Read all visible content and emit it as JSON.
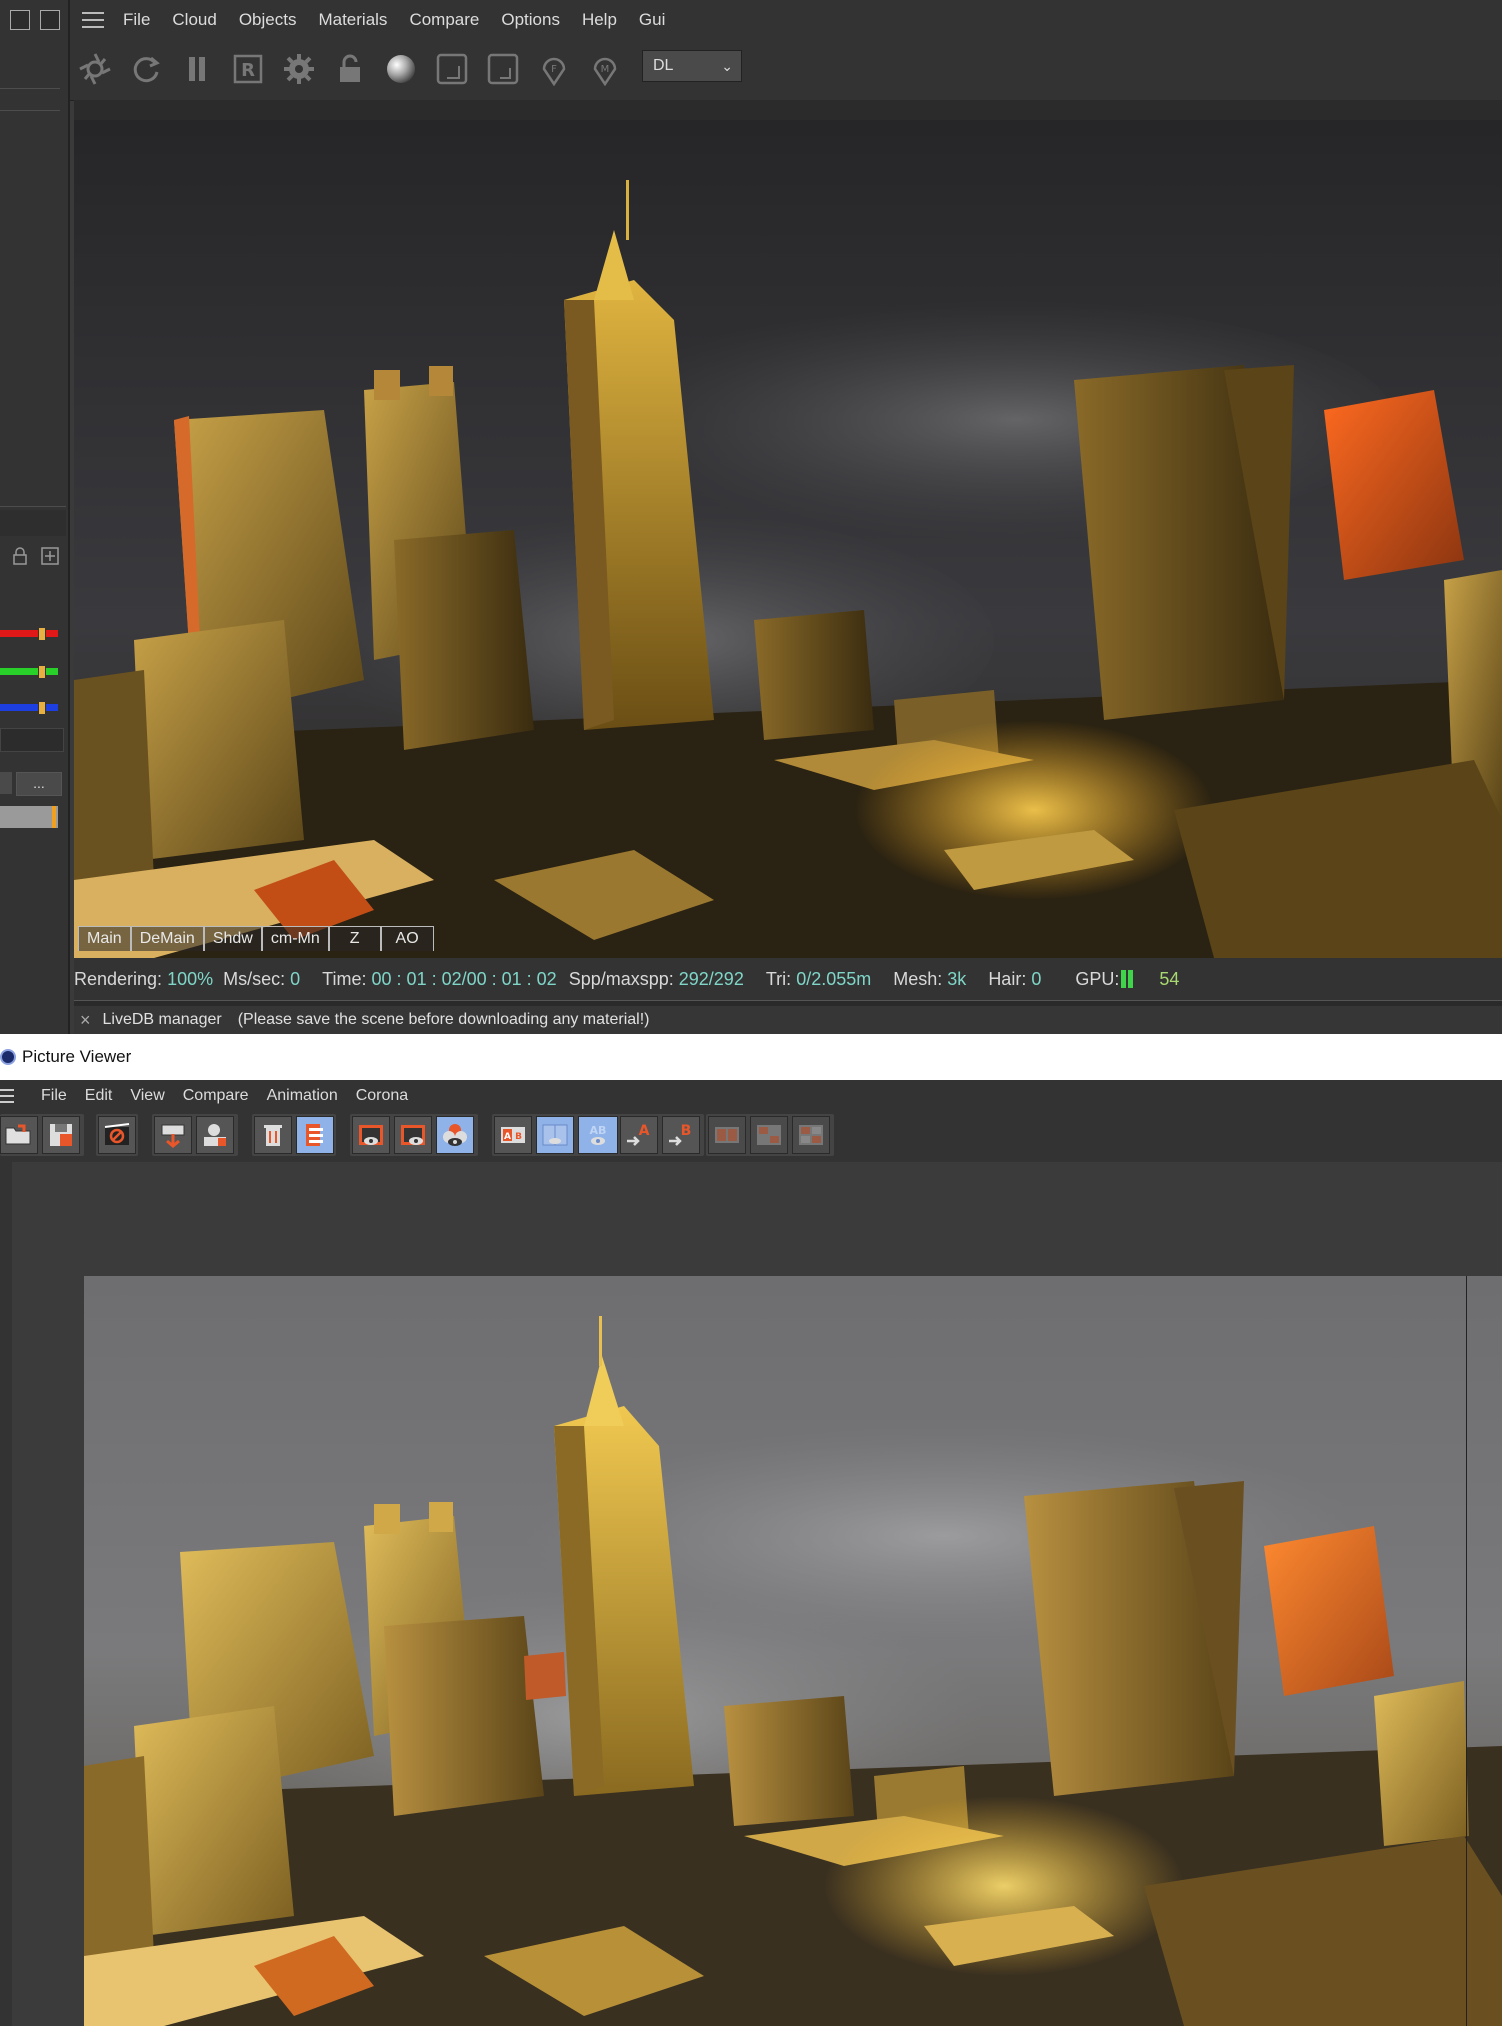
{
  "top": {
    "menu": [
      "File",
      "Cloud",
      "Objects",
      "Materials",
      "Compare",
      "Options",
      "Help",
      "Gui"
    ],
    "toolbar_icons": [
      "send-scene-icon",
      "restart-render-icon",
      "pause-icon",
      "r-region-icon",
      "settings-gear-icon",
      "lock-icon",
      "material-sphere-icon",
      "clay-mode-icon",
      "subsampling-icon",
      "focus-picker-icon",
      "material-picker-icon"
    ],
    "kernel_select": "DL",
    "left_panel": {
      "more_button": "..."
    },
    "pass_tabs": [
      "Main",
      "DeMain",
      "Shdw",
      "cm-Mn",
      "Z",
      "AO"
    ],
    "status": {
      "rendering_label": "Rendering:",
      "rendering_value": "100%",
      "mssec_label": "Ms/sec:",
      "mssec_value": "0",
      "time_label": "Time:",
      "time_value": "00 : 01 : 02/00 : 01 : 02",
      "spp_label": "Spp/maxspp:",
      "spp_value": "292/292",
      "tri_label": "Tri:",
      "tri_value": "0/2.055m",
      "mesh_label": "Mesh:",
      "mesh_value": "3k",
      "hair_label": "Hair:",
      "hair_value": "0",
      "gpu_label": "GPU:",
      "gpu_value": "54"
    },
    "livedb": {
      "close": "×",
      "title": "LiveDB manager",
      "message": "(Please save the scene before downloading any material!)"
    }
  },
  "picture_viewer": {
    "title": "Picture Viewer",
    "menu": [
      "File",
      "Edit",
      "View",
      "Compare",
      "Animation",
      "Corona"
    ],
    "toolbar_icons": [
      "open-icon",
      "save-icon",
      "stop-render-icon",
      "auto-crop-icon",
      "save-image-icon",
      "delete-icon",
      "film-strip-icon",
      "show-region-icon",
      "show-region-alt-icon",
      "show-compare-icon",
      "ab-compare-icon",
      "ab-split-icon",
      "ab-overlay-icon",
      "set-a-icon",
      "set-b-icon",
      "tile-1-icon",
      "tile-2-icon",
      "tile-3-icon"
    ],
    "set_a": "A",
    "set_b": "B",
    "ab": "AB"
  },
  "colors": {
    "status_value": "#7fd6c8",
    "gpu_bar": "#3fd44a",
    "accent_orange": "#e8562a",
    "selected_blue": "#8fb3e8"
  }
}
